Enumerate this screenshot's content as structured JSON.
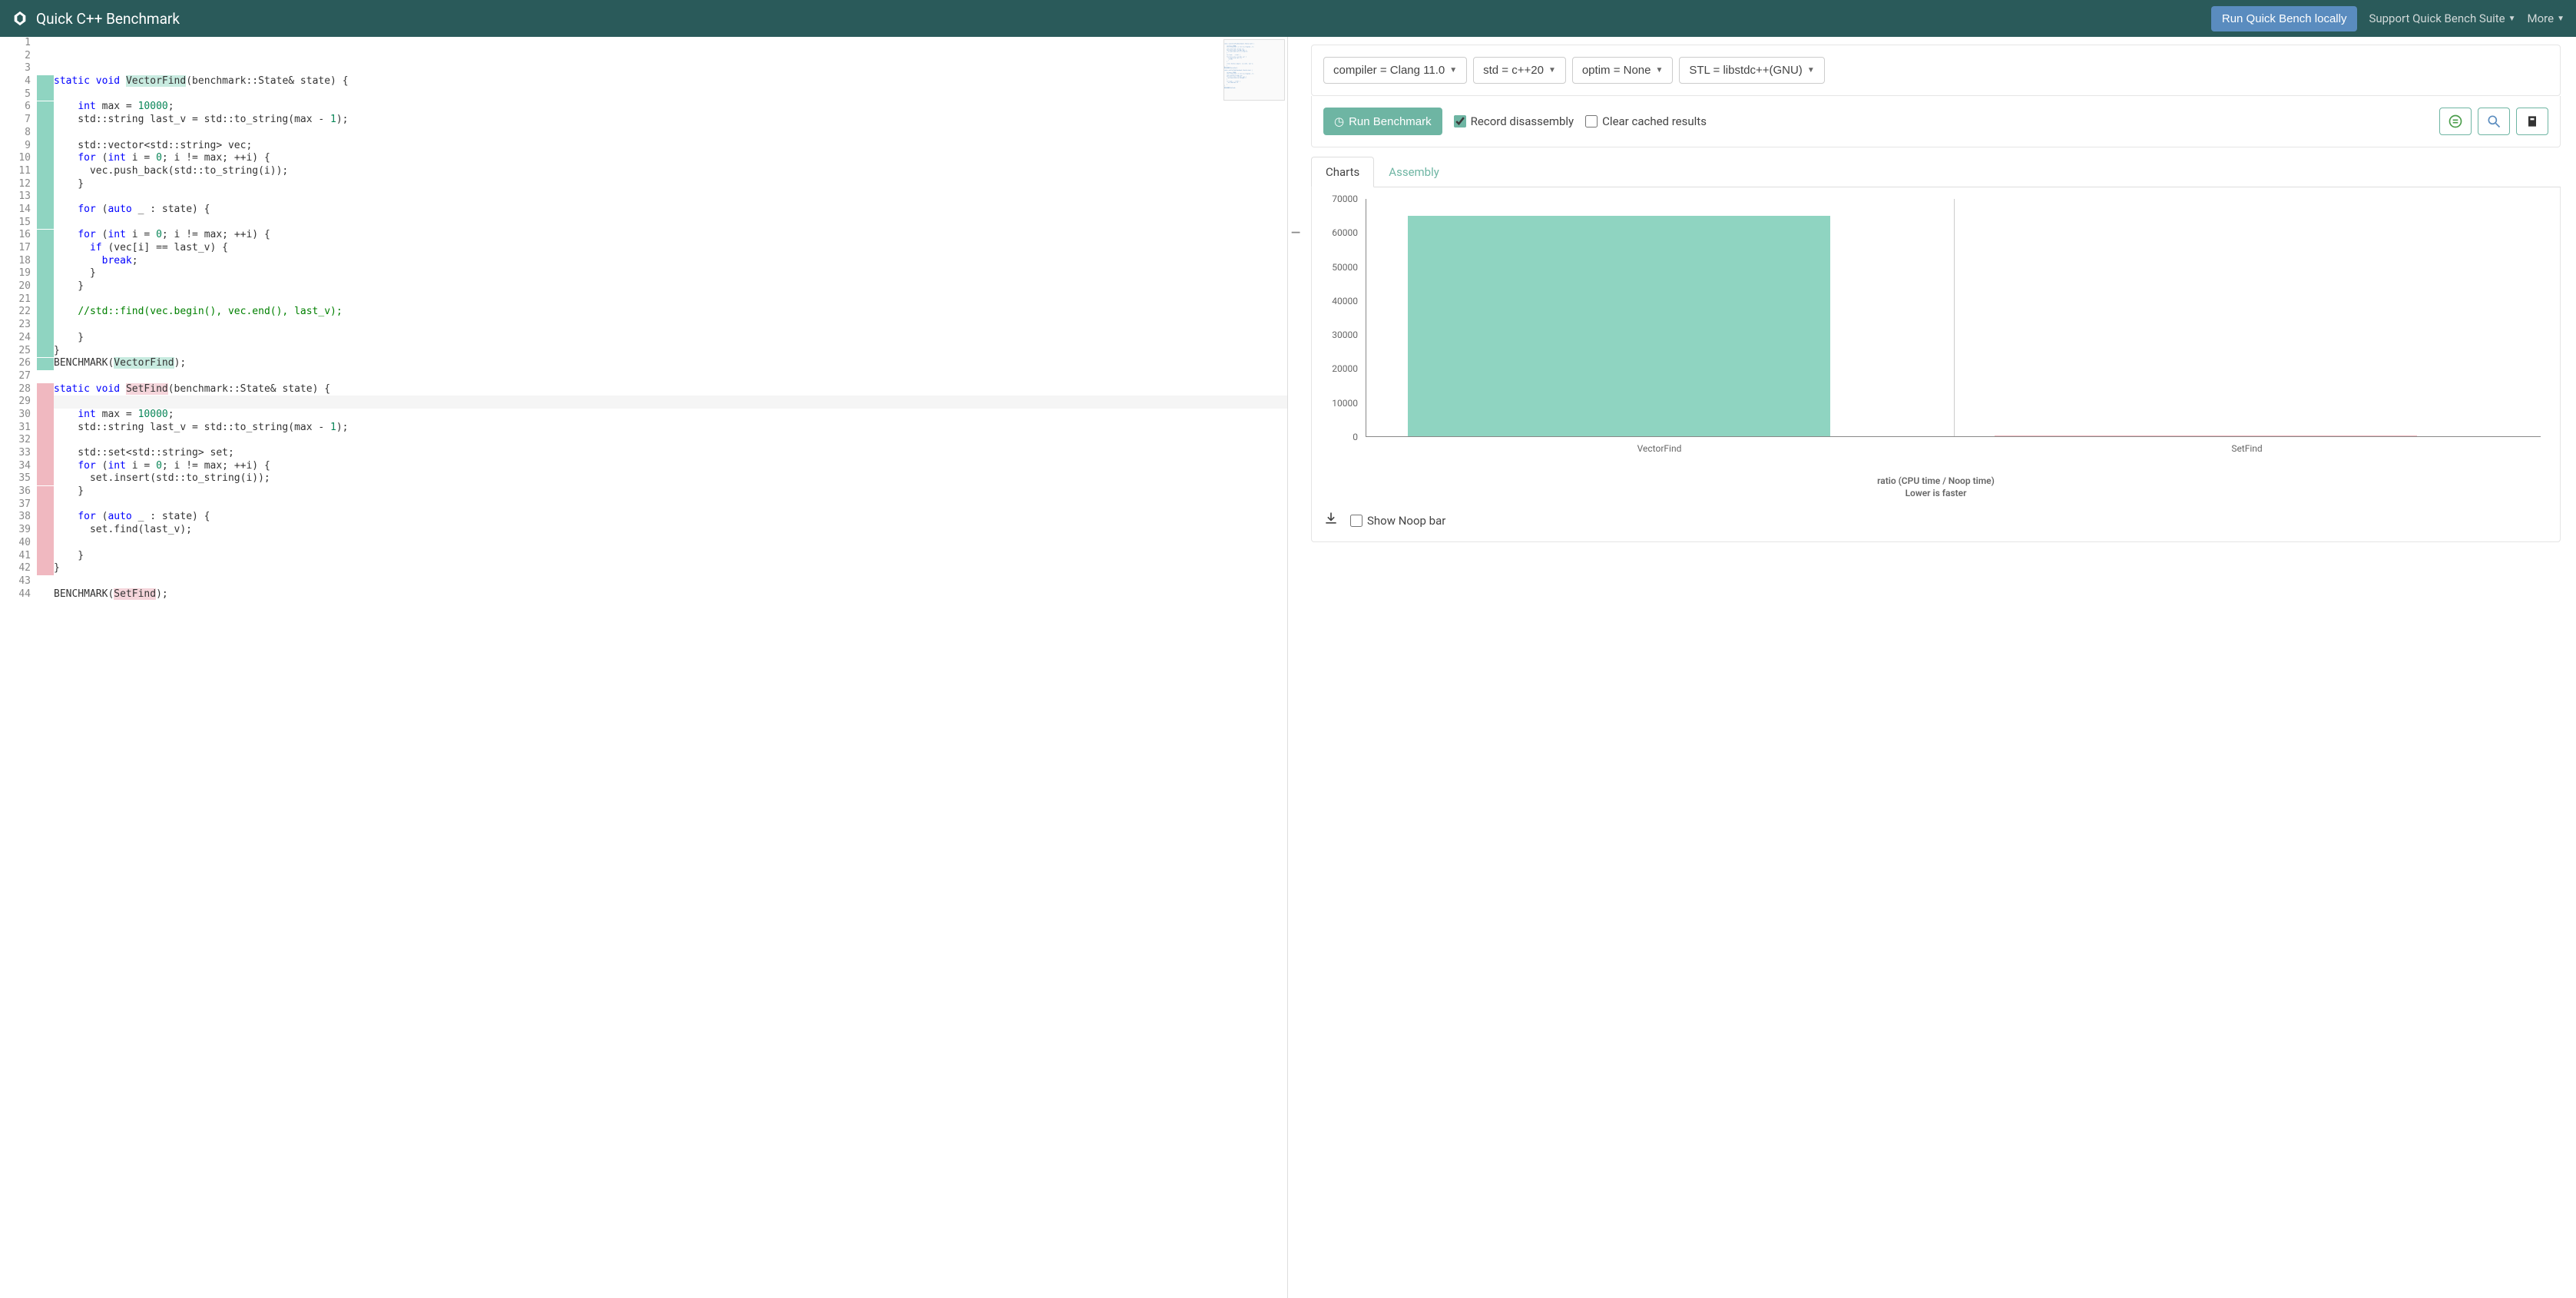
{
  "header": {
    "title": "Quick C++ Benchmark",
    "local_btn": "Run Quick Bench locally",
    "support_link": "Support Quick Bench Suite",
    "more_link": "More"
  },
  "config": {
    "compiler": "compiler = Clang 11.0",
    "std": "std = c++20",
    "optim": "optim = None",
    "stl": "STL = libstdc++(GNU)"
  },
  "actions": {
    "run": "Run Benchmark",
    "record": "Record disassembly",
    "clear": "Clear cached results"
  },
  "tabs": {
    "charts": "Charts",
    "assembly": "Assembly"
  },
  "chart_footer": {
    "show_noop": "Show Noop bar"
  },
  "chart_data": {
    "type": "bar",
    "categories": [
      "VectorFind",
      "SetFind"
    ],
    "series": [
      {
        "name": "VectorFind",
        "value": 65000,
        "color": "#8fd4c1"
      },
      {
        "name": "SetFind",
        "value": 200,
        "color": "#f0b8c0"
      }
    ],
    "ylim": [
      0,
      70000
    ],
    "yticks": [
      0,
      10000,
      20000,
      30000,
      40000,
      50000,
      60000,
      70000
    ],
    "caption_line1": "ratio (CPU time / Noop time)",
    "caption_line2": "Lower is faster"
  },
  "code": {
    "lines": [
      "",
      "",
      "",
      {
        "hl": "g",
        "tokens": [
          [
            "kw",
            "static"
          ],
          [
            "",
            " "
          ],
          [
            "kw",
            "void"
          ],
          [
            "",
            " "
          ],
          [
            "fn-hl-g",
            "VectorFind"
          ],
          [
            "",
            "(benchmark::State& state) {"
          ]
        ]
      },
      {
        "hl": "g",
        "text": ""
      },
      {
        "hl": "g",
        "tokens": [
          [
            "",
            "    "
          ],
          [
            "kw",
            "int"
          ],
          [
            "",
            " max = "
          ],
          [
            "num",
            "10000"
          ],
          [
            "",
            ";"
          ]
        ]
      },
      {
        "hl": "g",
        "tokens": [
          [
            "",
            "    std::string last_v = std::to_string(max - "
          ],
          [
            "num",
            "1"
          ],
          [
            "",
            ");"
          ]
        ]
      },
      {
        "hl": "g",
        "text": ""
      },
      {
        "hl": "g",
        "tokens": [
          [
            "",
            "    std::vector<std::string> vec;"
          ]
        ]
      },
      {
        "hl": "g",
        "tokens": [
          [
            "",
            "    "
          ],
          [
            "kw",
            "for"
          ],
          [
            "",
            " ("
          ],
          [
            "kw",
            "int"
          ],
          [
            "",
            " i = "
          ],
          [
            "num",
            "0"
          ],
          [
            "",
            "; i != max; ++i) {"
          ]
        ]
      },
      {
        "hl": "g",
        "tokens": [
          [
            "",
            "      vec.push_back(std::to_string(i));"
          ]
        ]
      },
      {
        "hl": "g",
        "tokens": [
          [
            "",
            "    }"
          ]
        ]
      },
      {
        "hl": "g",
        "text": ""
      },
      {
        "hl": "g",
        "tokens": [
          [
            "",
            "    "
          ],
          [
            "kw",
            "for"
          ],
          [
            "",
            " ("
          ],
          [
            "kw",
            "auto"
          ],
          [
            "",
            " _ : state) {"
          ]
        ]
      },
      {
        "hl": "g",
        "text": ""
      },
      {
        "hl": "g",
        "tokens": [
          [
            "",
            "    "
          ],
          [
            "kw",
            "for"
          ],
          [
            "",
            " ("
          ],
          [
            "kw",
            "int"
          ],
          [
            "",
            " i = "
          ],
          [
            "num",
            "0"
          ],
          [
            "",
            "; i != max; ++i) {"
          ]
        ]
      },
      {
        "hl": "g",
        "tokens": [
          [
            "",
            "      "
          ],
          [
            "kw",
            "if"
          ],
          [
            "",
            " (vec[i] == last_v) {"
          ]
        ]
      },
      {
        "hl": "g",
        "tokens": [
          [
            "",
            "        "
          ],
          [
            "kw",
            "break"
          ],
          [
            "",
            ";"
          ]
        ]
      },
      {
        "hl": "g",
        "tokens": [
          [
            "",
            "      }"
          ]
        ]
      },
      {
        "hl": "g",
        "tokens": [
          [
            "",
            "    }"
          ]
        ]
      },
      {
        "hl": "g",
        "text": ""
      },
      {
        "hl": "g",
        "tokens": [
          [
            "",
            "    "
          ],
          [
            "cm",
            "//std::find(vec.begin(), vec.end(), last_v);"
          ]
        ]
      },
      {
        "hl": "g",
        "text": ""
      },
      {
        "hl": "g",
        "tokens": [
          [
            "",
            "    }"
          ]
        ]
      },
      {
        "hl": "g",
        "tokens": [
          [
            "",
            "}"
          ]
        ]
      },
      {
        "hl": "g",
        "tokens": [
          [
            "",
            "BENCHMARK("
          ],
          [
            "fn-hl-g",
            "VectorFind"
          ],
          [
            "",
            ");"
          ]
        ]
      },
      "",
      {
        "hl": "p",
        "tokens": [
          [
            "kw",
            "static"
          ],
          [
            "",
            " "
          ],
          [
            "kw",
            "void"
          ],
          [
            "",
            " "
          ],
          [
            "fn-hl-p",
            "SetFind"
          ],
          [
            "",
            "(benchmark::State& state) {"
          ]
        ]
      },
      {
        "hl": "p",
        "cursor": true,
        "text": ""
      },
      {
        "hl": "p",
        "tokens": [
          [
            "",
            "    "
          ],
          [
            "kw",
            "int"
          ],
          [
            "",
            " max = "
          ],
          [
            "num",
            "10000"
          ],
          [
            "",
            ";"
          ]
        ]
      },
      {
        "hl": "p",
        "tokens": [
          [
            "",
            "    std::string last_v = std::to_string(max - "
          ],
          [
            "num",
            "1"
          ],
          [
            "",
            ");"
          ]
        ]
      },
      {
        "hl": "p",
        "text": ""
      },
      {
        "hl": "p",
        "tokens": [
          [
            "",
            "    std::set<std::string> set;"
          ]
        ]
      },
      {
        "hl": "p",
        "tokens": [
          [
            "",
            "    "
          ],
          [
            "kw",
            "for"
          ],
          [
            "",
            " ("
          ],
          [
            "kw",
            "int"
          ],
          [
            "",
            " i = "
          ],
          [
            "num",
            "0"
          ],
          [
            "",
            "; i != max; ++i) {"
          ]
        ]
      },
      {
        "hl": "p",
        "tokens": [
          [
            "",
            "      set.insert(std::to_string(i));"
          ]
        ]
      },
      {
        "hl": "p",
        "tokens": [
          [
            "",
            "    }"
          ]
        ]
      },
      {
        "hl": "p",
        "text": ""
      },
      {
        "hl": "p",
        "tokens": [
          [
            "",
            "    "
          ],
          [
            "kw",
            "for"
          ],
          [
            "",
            " ("
          ],
          [
            "kw",
            "auto"
          ],
          [
            "",
            " _ : state) {"
          ]
        ]
      },
      {
        "hl": "p",
        "tokens": [
          [
            "",
            "      set.find(last_v);"
          ]
        ]
      },
      {
        "hl": "p",
        "text": ""
      },
      {
        "hl": "p",
        "tokens": [
          [
            "",
            "    }"
          ]
        ]
      },
      {
        "hl": "p",
        "tokens": [
          [
            "",
            "}"
          ]
        ]
      },
      "",
      {
        "tokens": [
          [
            "",
            "BENCHMARK("
          ],
          [
            "fn-hl-p",
            "SetFind"
          ],
          [
            "",
            ");"
          ]
        ]
      }
    ]
  }
}
